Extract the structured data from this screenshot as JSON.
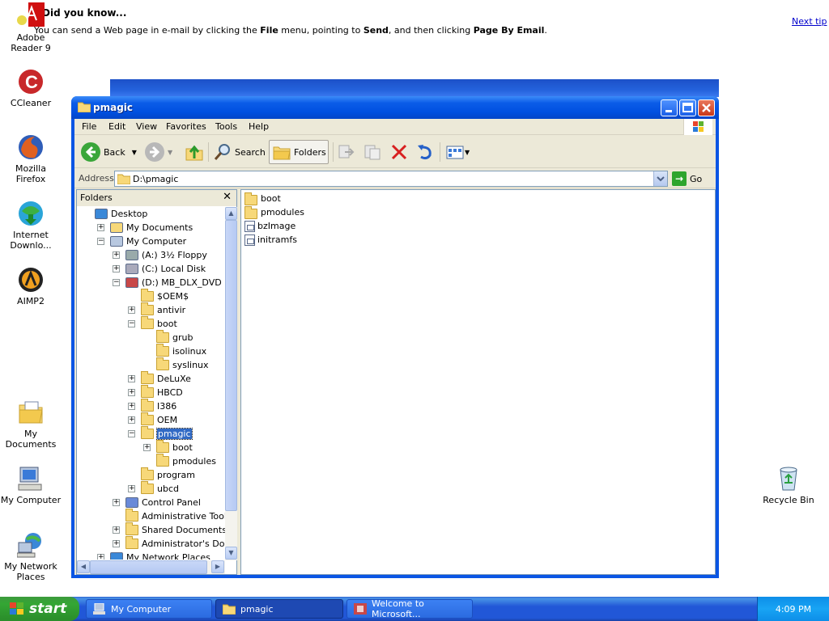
{
  "tip": {
    "title": "Did you know...",
    "text_parts": [
      "You can send a Web page in e-mail by clicking the ",
      "File",
      " menu, pointing to ",
      "Send",
      ", and then clicking ",
      "Page By Email",
      "."
    ],
    "next_tip": "Next tip"
  },
  "desktop": {
    "icons": [
      {
        "label": "Adobe Reader 9",
        "icon": "adobe-reader-icon"
      },
      {
        "label": "CCleaner",
        "icon": "ccleaner-icon"
      },
      {
        "label": "Mozilla Firefox",
        "icon": "firefox-icon"
      },
      {
        "label": "Internet Downlo...",
        "icon": "internet-download-manager-icon"
      },
      {
        "label": "AIMP2",
        "icon": "aimp-icon"
      },
      {
        "label": "My Documents",
        "icon": "my-documents-icon"
      },
      {
        "label": "My Computer",
        "icon": "my-computer-icon"
      },
      {
        "label": "My Network Places",
        "icon": "network-places-icon"
      },
      {
        "label": "Recycle Bin",
        "icon": "recycle-bin-icon"
      }
    ]
  },
  "window": {
    "title": "pmagic",
    "menu": [
      "File",
      "Edit",
      "View",
      "Favorites",
      "Tools",
      "Help"
    ],
    "toolbar": {
      "back": "Back",
      "search": "Search",
      "folders": "Folders"
    },
    "address": {
      "label": "Address",
      "value": "D:\\pmagic",
      "go": "Go"
    },
    "folders_pane": {
      "title": "Folders",
      "tree": [
        {
          "label": "Desktop",
          "level": 0,
          "expander": "",
          "icon": "desktop"
        },
        {
          "label": "My Documents",
          "level": 1,
          "expander": "+",
          "icon": "mydocs"
        },
        {
          "label": "My Computer",
          "level": 1,
          "expander": "-",
          "icon": "computer"
        },
        {
          "label": "(A:) 3½ Floppy",
          "level": 2,
          "expander": "+",
          "icon": "floppy"
        },
        {
          "label": "(C:) Local Disk",
          "level": 2,
          "expander": "+",
          "icon": "disk"
        },
        {
          "label": "(D:) MB_DLX_DVD",
          "level": 2,
          "expander": "-",
          "icon": "dvd"
        },
        {
          "label": "$OEM$",
          "level": 3,
          "expander": "",
          "icon": "folder"
        },
        {
          "label": "antivir",
          "level": 3,
          "expander": "+",
          "icon": "folder"
        },
        {
          "label": "boot",
          "level": 3,
          "expander": "-",
          "icon": "folder"
        },
        {
          "label": "grub",
          "level": 4,
          "expander": "",
          "icon": "folder"
        },
        {
          "label": "isolinux",
          "level": 4,
          "expander": "",
          "icon": "folder"
        },
        {
          "label": "syslinux",
          "level": 4,
          "expander": "",
          "icon": "folder"
        },
        {
          "label": "DeLuXe",
          "level": 3,
          "expander": "+",
          "icon": "folder"
        },
        {
          "label": "HBCD",
          "level": 3,
          "expander": "+",
          "icon": "folder"
        },
        {
          "label": "I386",
          "level": 3,
          "expander": "+",
          "icon": "folder"
        },
        {
          "label": "OEM",
          "level": 3,
          "expander": "+",
          "icon": "folder"
        },
        {
          "label": "pmagic",
          "level": 3,
          "expander": "-",
          "icon": "folder",
          "selected": true
        },
        {
          "label": "boot",
          "level": 4,
          "expander": "+",
          "icon": "folder"
        },
        {
          "label": "pmodules",
          "level": 4,
          "expander": "",
          "icon": "folder"
        },
        {
          "label": "program",
          "level": 3,
          "expander": "",
          "icon": "folder"
        },
        {
          "label": "ubcd",
          "level": 3,
          "expander": "+",
          "icon": "folder"
        },
        {
          "label": "Control Panel",
          "level": 2,
          "expander": "+",
          "icon": "control"
        },
        {
          "label": "Administrative Tools",
          "level": 2,
          "expander": "",
          "icon": "folder"
        },
        {
          "label": "Shared Documents",
          "level": 2,
          "expander": "+",
          "icon": "folder"
        },
        {
          "label": "Administrator's Documents",
          "level": 2,
          "expander": "+",
          "icon": "folder"
        },
        {
          "label": "My Network Places",
          "level": 1,
          "expander": "+",
          "icon": "network"
        }
      ]
    },
    "files": [
      {
        "name": "boot",
        "type": "folder"
      },
      {
        "name": "pmodules",
        "type": "folder"
      },
      {
        "name": "bzImage",
        "type": "file"
      },
      {
        "name": "initramfs",
        "type": "file"
      }
    ]
  },
  "taskbar": {
    "start": "start",
    "tasks": [
      {
        "label": "My Computer",
        "active": false
      },
      {
        "label": "pmagic",
        "active": true
      },
      {
        "label": "Welcome to Microsoft...",
        "active": false
      }
    ],
    "clock": "4:09 PM"
  }
}
